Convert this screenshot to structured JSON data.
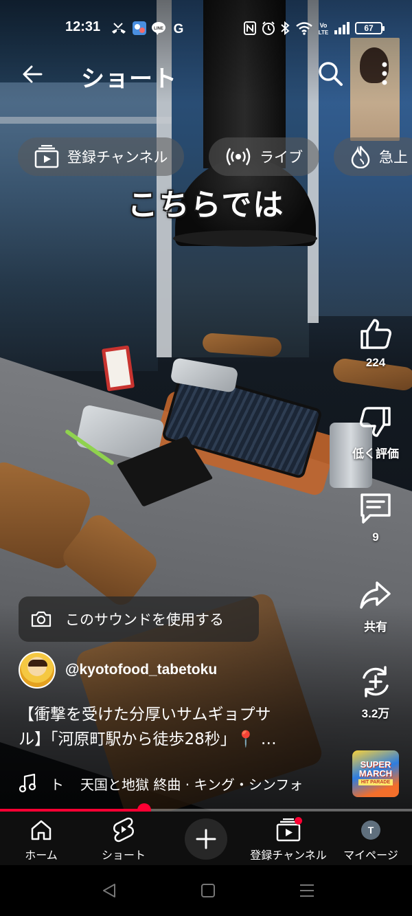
{
  "status_bar": {
    "time": "12:31",
    "left_icons": [
      "missed-call-icon",
      "app-icon",
      "line-icon",
      "google-icon"
    ],
    "right_icons": [
      "nfc-icon",
      "alarm-icon",
      "bluetooth-icon",
      "wifi-icon",
      "volte-icon",
      "signal-icon"
    ],
    "battery": "67"
  },
  "header": {
    "title": "ショート"
  },
  "chips": [
    {
      "label": "登録チャンネル",
      "icon": "subscriptions-icon"
    },
    {
      "label": "ライブ",
      "icon": "live-icon"
    },
    {
      "label": "急上",
      "icon": "trending-icon"
    }
  ],
  "video": {
    "caption": "こちらでは"
  },
  "actions": {
    "like_count": "224",
    "dislike_label": "低く評価",
    "comment_count": "9",
    "share_label": "共有",
    "remix_count": "3.2万"
  },
  "sound_button": {
    "label": "このサウンドを使用する"
  },
  "channel": {
    "handle": "@kyotofood_tabetoku"
  },
  "description": {
    "line1": "【衝撃を受けた分厚いサムギョプサ",
    "line2": "ル】「河原町駅から徒歩28秒」📍 …"
  },
  "music": {
    "prefix": "ト",
    "track": "天国と地獄 終曲 · キング・シンフォ"
  },
  "album_art": {
    "line1": "SUPER",
    "line2": "MARCH",
    "line3": "HIT PARADE"
  },
  "progress": {
    "fraction": 0.35
  },
  "bottom_nav": {
    "home": "ホーム",
    "shorts": "ショート",
    "subscriptions": "登録チャンネル",
    "mypage": "マイページ",
    "avatar_letter": "T"
  },
  "colors": {
    "accent": "#ff0033",
    "nav_bg": "#0f0f0f"
  }
}
